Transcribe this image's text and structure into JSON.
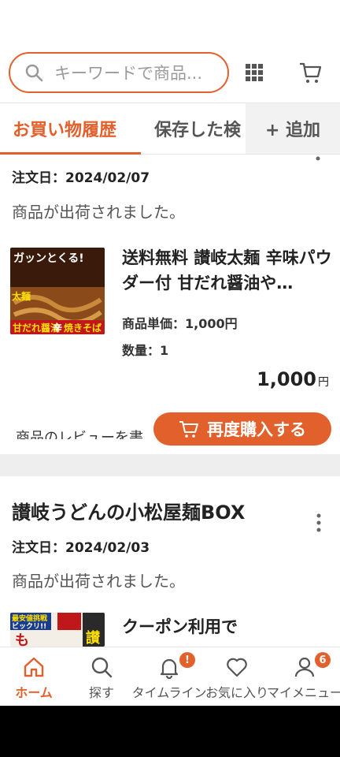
{
  "search": {
    "placeholder": "キーワードで商品..."
  },
  "tabs": {
    "active": "お買い物履歴",
    "second": "保存した検",
    "add": "+ 追加"
  },
  "orders": [
    {
      "date": "注文日：2024/02/07",
      "status": "商品が出荷されました。",
      "thumb_text": [
        "ガッンとくる!",
        "甘だれ醤油",
        "辛",
        "焼きそば",
        "太麺"
      ],
      "title": "送料無料 讃岐太麺 辛味パウダー付 甘だれ醤油や…",
      "unit_price": "商品単価：1,000円",
      "qty": "数量：1",
      "price": "1,000",
      "price_unit": "円",
      "review": "商品のレビューを書",
      "rebuy": "再度購入する"
    },
    {
      "shop": "讃岐うどんの小松屋麺BOX",
      "date": "注文日：2024/02/03",
      "status": "商品が出荷されました。",
      "thumb_text": [
        "最安値挑戦",
        "ビックリ!!",
        "も",
        "讃"
      ],
      "title": "クーポン利用で"
    }
  ],
  "nav": [
    {
      "label": "ホーム",
      "icon": "home-icon",
      "active": true
    },
    {
      "label": "探す",
      "icon": "search-icon"
    },
    {
      "label": "タイムライン",
      "icon": "bell-icon",
      "badge": "!"
    },
    {
      "label": "お気に入り",
      "icon": "heart-icon"
    },
    {
      "label": "マイメニュー",
      "icon": "user-icon",
      "badge": "6"
    }
  ],
  "colors": {
    "accent": "#e2602b",
    "divider": "#eeeeee"
  }
}
